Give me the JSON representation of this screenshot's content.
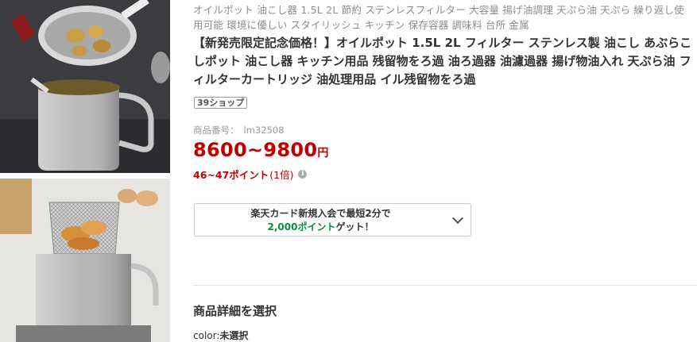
{
  "product": {
    "subtitle": "オイルポット 油こし器 1.5L 2L 節約 ステンレスフィルター 大容量 揚げ油調理 天ぷら油 天ぷら 繰り返し使用可能 環境に優しい スタイリッシュ キッチン 保存容器 調味料 台所 金属",
    "title": "【新発売限定記念価格！】オイルポット 1.5L 2L フィルター ステンレス製 油こし あぶらこしポット 油こし器 キッチン用品 残留物をろ過 油ろ過器 油濾過器 揚げ物油入れ 天ぷら油 フィルターカートリッジ 油処理用品 イル残留物をろ過",
    "shop_badge": "39ショップ",
    "item_number_label": "商品番号：",
    "item_number": "lm32508",
    "price_range": "8600~9800",
    "price_unit": "円",
    "points": "46~47ポイント",
    "points_multiplier": "(1倍)"
  },
  "promo": {
    "line1": "楽天カード新規入会で最短2分で",
    "line2_points": "2,000ポイント",
    "line2_suffix": "ゲット！"
  },
  "options": {
    "section_title": "商品詳細を選択",
    "color_label": "color:",
    "color_value": "未選択"
  },
  "colors": {
    "price": "#bf0000",
    "points_highlight": "#0a8f3c"
  }
}
